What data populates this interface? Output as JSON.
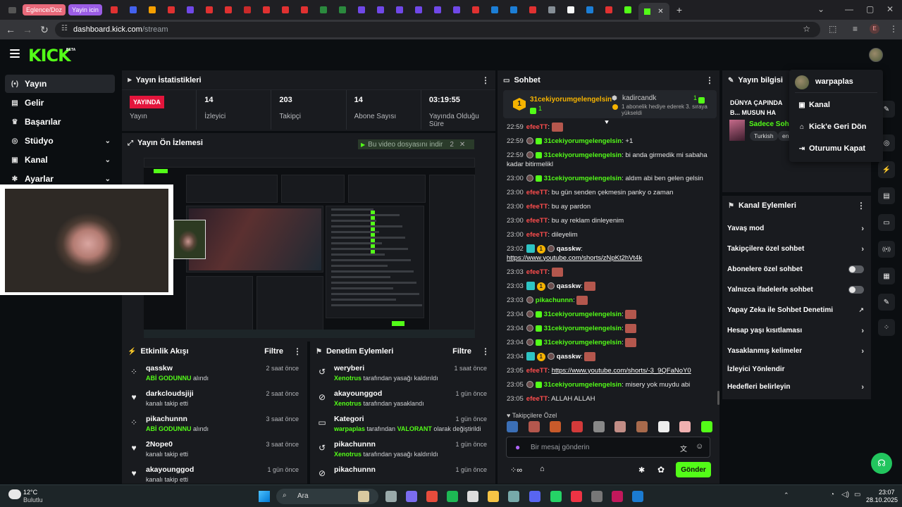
{
  "browser": {
    "tab_pills": [
      {
        "label": "Eglence/Doz",
        "color": "#e8697a"
      },
      {
        "label": "Yayin icin",
        "color": "#9b5de5"
      }
    ],
    "url_host": "dashboard.kick.com",
    "url_path": "/stream"
  },
  "header": {
    "logo": "KICK",
    "beta": "BETA"
  },
  "nav": [
    {
      "label": "Yayın",
      "icon": "broadcast-icon",
      "glyph": "(•)",
      "active": true,
      "chevron": false
    },
    {
      "label": "Gelir",
      "icon": "revenue-icon",
      "glyph": "▤",
      "active": false,
      "chevron": false
    },
    {
      "label": "Başarılar",
      "icon": "trophy-icon",
      "glyph": "♛",
      "active": false,
      "chevron": false
    },
    {
      "label": "Stüdyo",
      "icon": "studio-icon",
      "glyph": "◎",
      "active": false,
      "chevron": true
    },
    {
      "label": "Kanal",
      "icon": "channel-icon",
      "glyph": "▣",
      "active": false,
      "chevron": true
    },
    {
      "label": "Ayarlar",
      "icon": "settings-icon",
      "glyph": "✱",
      "active": false,
      "chevron": true
    }
  ],
  "stats": {
    "title": "Yayın İstatistikleri",
    "live_badge": "YAYINDA",
    "items": [
      {
        "value": "",
        "label": "Yayın"
      },
      {
        "value": "14",
        "label": "İzleyici"
      },
      {
        "value": "203",
        "label": "Takipçi"
      },
      {
        "value": "14",
        "label": "Abone Sayısı"
      },
      {
        "value": "03:19:55",
        "label": "Yayında Olduğu Süre"
      }
    ]
  },
  "preview": {
    "title": "Yayın Ön İzlemesi",
    "download_label": "Bu video dosyasını indir",
    "download_count": "2"
  },
  "activity": {
    "title": "Etkinlik Akışı",
    "filter": "Filtre",
    "items": [
      {
        "name": "qasskw",
        "sub_highlight": "ABİ GODUNNU",
        "sub": " alındı",
        "time": "2 saat önce",
        "glyph": "⁘"
      },
      {
        "name": "darkcloudsjiji",
        "sub_highlight": "",
        "sub": "kanalı takip etti",
        "time": "2 saat önce",
        "glyph": "♥"
      },
      {
        "name": "pikachunnn",
        "sub_highlight": "ABİ GODUNNU",
        "sub": " alındı",
        "time": "3 saat önce",
        "glyph": "⁘"
      },
      {
        "name": "2Nope0",
        "sub_highlight": "",
        "sub": "kanalı takip etti",
        "time": "3 saat önce",
        "glyph": "♥"
      },
      {
        "name": "akayounggod",
        "sub_highlight": "",
        "sub": "kanalı takip etti",
        "time": "1 gün önce",
        "glyph": "♥"
      }
    ]
  },
  "moderation": {
    "title": "Denetim Eylemleri",
    "filter": "Filtre",
    "items": [
      {
        "name": "weryberi",
        "sub_highlight": "Xenotrus",
        "sub": " tarafından yasağı kaldırıldı",
        "sub2_highlight": "",
        "sub2": "",
        "time": "1 saat önce",
        "glyph": "↺"
      },
      {
        "name": "akayounggod",
        "sub_highlight": "Xenotrus",
        "sub": " tarafından yasaklandı",
        "sub2_highlight": "",
        "sub2": "",
        "time": "1 gün önce",
        "glyph": "⊘"
      },
      {
        "name": "Kategori",
        "sub_highlight": "warpaplas",
        "sub": " tarafından ",
        "sub2_highlight": "VALORANT",
        "sub2": " olarak değiştirildi",
        "time": "1 gün önce",
        "glyph": "▭"
      },
      {
        "name": "pikachunnn",
        "sub_highlight": "Xenotrus",
        "sub": " tarafından yasağı kaldırıldı",
        "sub2_highlight": "",
        "sub2": "",
        "time": "1 gün önce",
        "glyph": "↺"
      },
      {
        "name": "pikachunnn",
        "sub_highlight": "",
        "sub": "",
        "sub2_highlight": "",
        "sub2": "",
        "time": "1 gün önce",
        "glyph": "⊘"
      }
    ]
  },
  "chat": {
    "title": "Sohbet",
    "pinned_user": "31cekiyorumgelengelsin",
    "pinned_count": "1",
    "gifter_name": "kadircandk",
    "gifter_count": "1",
    "gifter_text": "1 abonelik hediye ederek 3. sıraya yükseldi",
    "messages": [
      {
        "time": "22:59",
        "user": "efeeTT",
        "ucolor": "red",
        "text": "",
        "emote": true,
        "badges": ""
      },
      {
        "time": "22:59",
        "user": "31cekiyorumgelengelsin",
        "ucolor": "green",
        "text": "+1",
        "badges": "cg"
      },
      {
        "time": "22:59",
        "user": "31cekiyorumgelengelsin",
        "ucolor": "green",
        "text": "bi anda girmedik mi sabaha kadar bitirmelikl",
        "badges": "cg"
      },
      {
        "time": "23:00",
        "user": "31cekiyorumgelengelsin",
        "ucolor": "green",
        "text": "aldım abi ben gelen gelsin",
        "badges": "cg"
      },
      {
        "time": "23:00",
        "user": "efeeTT",
        "ucolor": "red",
        "text": "bu gün senden çekmesin panky o zaman",
        "badges": ""
      },
      {
        "time": "23:00",
        "user": "efeeTT",
        "ucolor": "red",
        "text": "bu ay pardon",
        "badges": ""
      },
      {
        "time": "23:00",
        "user": "efeeTT",
        "ucolor": "red",
        "text": "bu ay reklam dinleyenim",
        "badges": ""
      },
      {
        "time": "23:00",
        "user": "efeeTT",
        "ucolor": "red",
        "text": "dileyelim",
        "badges": ""
      },
      {
        "time": "23:02",
        "user": "qasskw",
        "ucolor": "white",
        "text": "",
        "link": "https://www.youtube.com/shorts/zNpKt2hVt4k",
        "badges": "tlc"
      },
      {
        "time": "23:03",
        "user": "efeeTT",
        "ucolor": "red",
        "text": "",
        "emote": true,
        "badges": ""
      },
      {
        "time": "23:03",
        "user": "qasskw",
        "ucolor": "white",
        "text": "",
        "emote": true,
        "badges": "tlc"
      },
      {
        "time": "23:03",
        "user": "pikachunnn",
        "ucolor": "green",
        "text": "",
        "emote": true,
        "badges": "c"
      },
      {
        "time": "23:04",
        "user": "31cekiyorumgelengelsin",
        "ucolor": "green",
        "text": "",
        "emote": true,
        "badges": "cg"
      },
      {
        "time": "23:04",
        "user": "31cekiyorumgelengelsin",
        "ucolor": "green",
        "text": "",
        "emote": true,
        "badges": "cg"
      },
      {
        "time": "23:04",
        "user": "31cekiyorumgelengelsin",
        "ucolor": "green",
        "text": "",
        "emote": true,
        "badges": "cg"
      },
      {
        "time": "23:04",
        "user": "qasskw",
        "ucolor": "white",
        "text": "",
        "emote": true,
        "badges": "tlc"
      },
      {
        "time": "23:05",
        "user": "efeeTT",
        "ucolor": "red",
        "text": "",
        "link": "https://www.youtube.com/shorts/-3_9QFaNoY0",
        "badges": ""
      },
      {
        "time": "23:05",
        "user": "31cekiyorumgelengelsin",
        "ucolor": "green",
        "text": "misery yok muydu abi",
        "badges": "cg"
      },
      {
        "time": "23:05",
        "user": "efeeTT",
        "ucolor": "red",
        "text": "ALLAH ALLAH",
        "badges": ""
      }
    ],
    "followers_only": "Takipçilere Özel",
    "input_placeholder": "Bir mesaj gönderin",
    "send": "Gönder"
  },
  "stream_info": {
    "title": "Yayın bilgisi",
    "stream_title": "DÜNYA ÇAPINDA B... MUSUN HA KANKA...",
    "category": "Sadece Sohbet",
    "tags": [
      "Turkish",
      "en"
    ]
  },
  "channel_actions": {
    "title": "Kanal Eylemleri",
    "items": [
      {
        "label": "Yavaş mod",
        "type": "chevron"
      },
      {
        "label": "Takipçilere özel sohbet",
        "type": "chevron"
      },
      {
        "label": "Abonelere özel sohbet",
        "type": "toggle"
      },
      {
        "label": "Yalnızca ifadelerle sohbet",
        "type": "toggle"
      },
      {
        "label": "Yapay Zeka ile Sohbet Denetimi",
        "type": "external"
      },
      {
        "label": "Hesap yaşı kısıtlaması",
        "type": "chevron"
      },
      {
        "label": "Yasaklanmış kelimeler",
        "type": "chevron"
      },
      {
        "label": "İzleyici Yönlendir",
        "type": "none"
      },
      {
        "label": "Hedefleri belirleyin",
        "type": "chevron"
      }
    ]
  },
  "dropdown": {
    "username": "warpaplas",
    "items": [
      {
        "label": "Kanal",
        "glyph": "▣",
        "icon": "channel-icon"
      },
      {
        "label": "Kick'e Geri Dön",
        "glyph": "⌂",
        "icon": "home-icon"
      },
      {
        "label": "Oturumu Kapat",
        "glyph": "⇥",
        "icon": "logout-icon"
      }
    ]
  },
  "taskbar": {
    "weather_temp": "12°C",
    "weather_desc": "Bulutlu",
    "search": "Ara",
    "time": "23:07",
    "date": "28.10.2025"
  },
  "colors": {
    "accent": "#53fc18",
    "live": "#e3153c",
    "panel": "#191b1f",
    "bg": "#0b0e11"
  }
}
